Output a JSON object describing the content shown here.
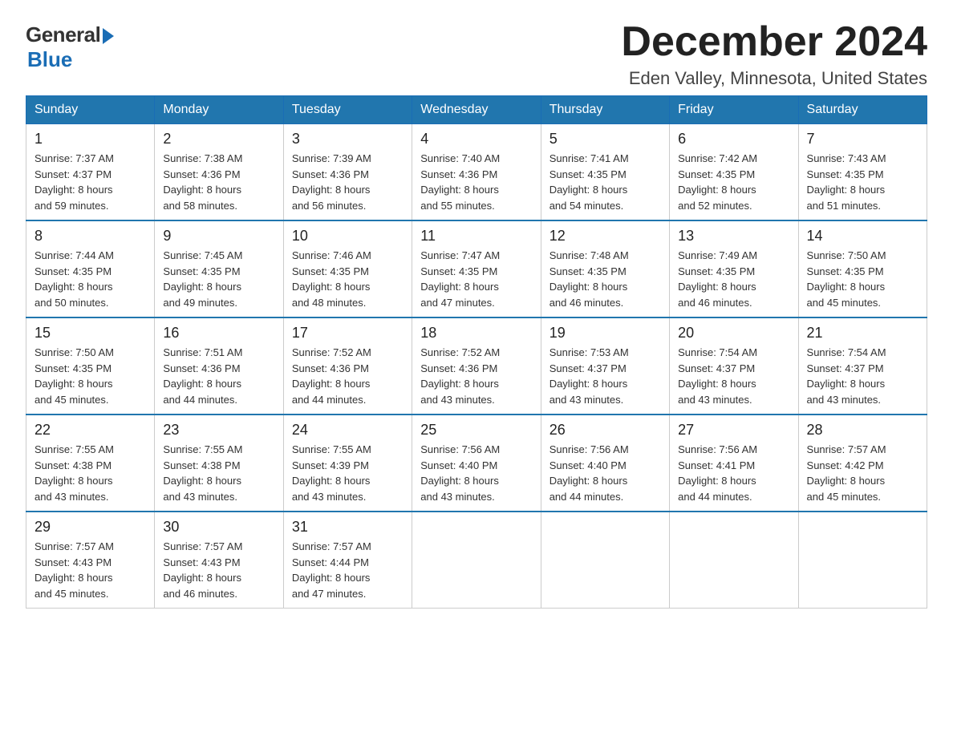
{
  "logo": {
    "general": "General",
    "blue": "Blue"
  },
  "header": {
    "month": "December 2024",
    "location": "Eden Valley, Minnesota, United States"
  },
  "weekdays": [
    "Sunday",
    "Monday",
    "Tuesday",
    "Wednesday",
    "Thursday",
    "Friday",
    "Saturday"
  ],
  "weeks": [
    [
      {
        "day": "1",
        "sunrise": "7:37 AM",
        "sunset": "4:37 PM",
        "daylight": "8 hours and 59 minutes."
      },
      {
        "day": "2",
        "sunrise": "7:38 AM",
        "sunset": "4:36 PM",
        "daylight": "8 hours and 58 minutes."
      },
      {
        "day": "3",
        "sunrise": "7:39 AM",
        "sunset": "4:36 PM",
        "daylight": "8 hours and 56 minutes."
      },
      {
        "day": "4",
        "sunrise": "7:40 AM",
        "sunset": "4:36 PM",
        "daylight": "8 hours and 55 minutes."
      },
      {
        "day": "5",
        "sunrise": "7:41 AM",
        "sunset": "4:35 PM",
        "daylight": "8 hours and 54 minutes."
      },
      {
        "day": "6",
        "sunrise": "7:42 AM",
        "sunset": "4:35 PM",
        "daylight": "8 hours and 52 minutes."
      },
      {
        "day": "7",
        "sunrise": "7:43 AM",
        "sunset": "4:35 PM",
        "daylight": "8 hours and 51 minutes."
      }
    ],
    [
      {
        "day": "8",
        "sunrise": "7:44 AM",
        "sunset": "4:35 PM",
        "daylight": "8 hours and 50 minutes."
      },
      {
        "day": "9",
        "sunrise": "7:45 AM",
        "sunset": "4:35 PM",
        "daylight": "8 hours and 49 minutes."
      },
      {
        "day": "10",
        "sunrise": "7:46 AM",
        "sunset": "4:35 PM",
        "daylight": "8 hours and 48 minutes."
      },
      {
        "day": "11",
        "sunrise": "7:47 AM",
        "sunset": "4:35 PM",
        "daylight": "8 hours and 47 minutes."
      },
      {
        "day": "12",
        "sunrise": "7:48 AM",
        "sunset": "4:35 PM",
        "daylight": "8 hours and 46 minutes."
      },
      {
        "day": "13",
        "sunrise": "7:49 AM",
        "sunset": "4:35 PM",
        "daylight": "8 hours and 46 minutes."
      },
      {
        "day": "14",
        "sunrise": "7:50 AM",
        "sunset": "4:35 PM",
        "daylight": "8 hours and 45 minutes."
      }
    ],
    [
      {
        "day": "15",
        "sunrise": "7:50 AM",
        "sunset": "4:35 PM",
        "daylight": "8 hours and 45 minutes."
      },
      {
        "day": "16",
        "sunrise": "7:51 AM",
        "sunset": "4:36 PM",
        "daylight": "8 hours and 44 minutes."
      },
      {
        "day": "17",
        "sunrise": "7:52 AM",
        "sunset": "4:36 PM",
        "daylight": "8 hours and 44 minutes."
      },
      {
        "day": "18",
        "sunrise": "7:52 AM",
        "sunset": "4:36 PM",
        "daylight": "8 hours and 43 minutes."
      },
      {
        "day": "19",
        "sunrise": "7:53 AM",
        "sunset": "4:37 PM",
        "daylight": "8 hours and 43 minutes."
      },
      {
        "day": "20",
        "sunrise": "7:54 AM",
        "sunset": "4:37 PM",
        "daylight": "8 hours and 43 minutes."
      },
      {
        "day": "21",
        "sunrise": "7:54 AM",
        "sunset": "4:37 PM",
        "daylight": "8 hours and 43 minutes."
      }
    ],
    [
      {
        "day": "22",
        "sunrise": "7:55 AM",
        "sunset": "4:38 PM",
        "daylight": "8 hours and 43 minutes."
      },
      {
        "day": "23",
        "sunrise": "7:55 AM",
        "sunset": "4:38 PM",
        "daylight": "8 hours and 43 minutes."
      },
      {
        "day": "24",
        "sunrise": "7:55 AM",
        "sunset": "4:39 PM",
        "daylight": "8 hours and 43 minutes."
      },
      {
        "day": "25",
        "sunrise": "7:56 AM",
        "sunset": "4:40 PM",
        "daylight": "8 hours and 43 minutes."
      },
      {
        "day": "26",
        "sunrise": "7:56 AM",
        "sunset": "4:40 PM",
        "daylight": "8 hours and 44 minutes."
      },
      {
        "day": "27",
        "sunrise": "7:56 AM",
        "sunset": "4:41 PM",
        "daylight": "8 hours and 44 minutes."
      },
      {
        "day": "28",
        "sunrise": "7:57 AM",
        "sunset": "4:42 PM",
        "daylight": "8 hours and 45 minutes."
      }
    ],
    [
      {
        "day": "29",
        "sunrise": "7:57 AM",
        "sunset": "4:43 PM",
        "daylight": "8 hours and 45 minutes."
      },
      {
        "day": "30",
        "sunrise": "7:57 AM",
        "sunset": "4:43 PM",
        "daylight": "8 hours and 46 minutes."
      },
      {
        "day": "31",
        "sunrise": "7:57 AM",
        "sunset": "4:44 PM",
        "daylight": "8 hours and 47 minutes."
      },
      null,
      null,
      null,
      null
    ]
  ],
  "labels": {
    "sunrise": "Sunrise:",
    "sunset": "Sunset:",
    "daylight": "Daylight:"
  }
}
